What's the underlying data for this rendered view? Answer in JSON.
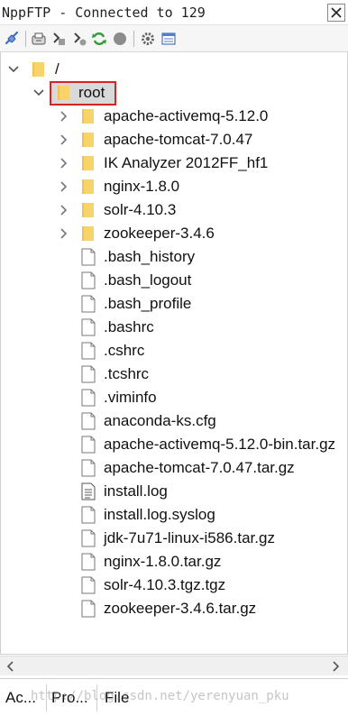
{
  "window": {
    "title": "NppFTP - Connected to 129"
  },
  "toolbar": {
    "buttons": [
      {
        "icon": "connect-icon"
      },
      {
        "icon": "download-icon"
      },
      {
        "icon": "upload-icon"
      },
      {
        "icon": "upload-to-icon"
      },
      {
        "icon": "refresh-icon"
      },
      {
        "icon": "abort-icon"
      },
      {
        "icon": "settings-icon"
      },
      {
        "icon": "message-window-icon"
      }
    ]
  },
  "tree": {
    "root": "/",
    "selected": "root",
    "folders": [
      "apache-activemq-5.12.0",
      "apache-tomcat-7.0.47",
      "IK Analyzer 2012FF_hf1",
      "nginx-1.8.0",
      "solr-4.10.3",
      "zookeeper-3.4.6"
    ],
    "files": [
      ".bash_history",
      ".bash_logout",
      ".bash_profile",
      ".bashrc",
      ".cshrc",
      ".tcshrc",
      ".viminfo",
      "anaconda-ks.cfg",
      "apache-activemq-5.12.0-bin.tar.gz",
      "apache-tomcat-7.0.47.tar.gz",
      "install.log",
      "install.log.syslog",
      "jdk-7u71-linux-i586.tar.gz",
      "nginx-1.8.0.tar.gz",
      "solr-4.10.3.tgz.tgz",
      "zookeeper-3.4.6.tar.gz"
    ]
  },
  "tabs": [
    "Ac...",
    "Pro...",
    "File"
  ],
  "watermark": "http://blog.csdn.net/yerenyuan_pku",
  "colors": {
    "folder": "#f2c24a",
    "selection_border": "#d62424",
    "selection_fill": "#d9d9d9",
    "refresh": "#2e9a3a",
    "connect": "#3a6fc4"
  }
}
